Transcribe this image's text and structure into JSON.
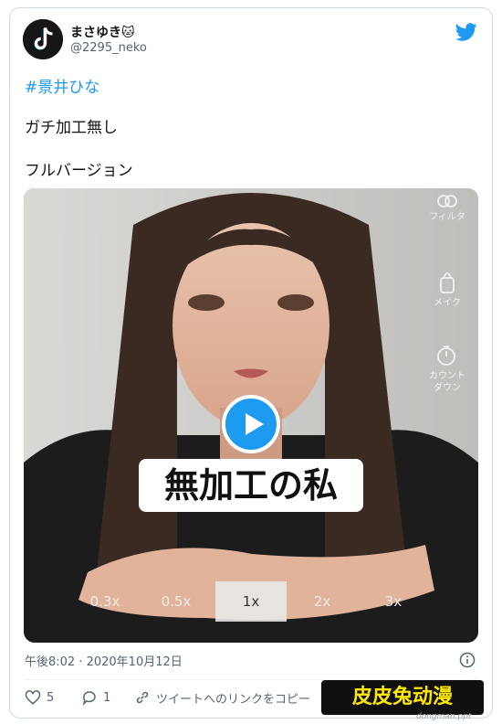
{
  "tweet": {
    "display_name": "まさゆき🐱",
    "handle": "@2295_neko",
    "hashtag": "#景井ひな",
    "text_line1": "ガチ加工無し",
    "text_line2": "フルバージョン",
    "timestamp": "午後8:02 · 2020年10月12日"
  },
  "video": {
    "caption": "無加工の私",
    "tools": [
      {
        "label": "フィルタ",
        "icon": "filter-icon"
      },
      {
        "label": "メイク",
        "icon": "makeup-icon"
      },
      {
        "label": "カウント\nダウン",
        "icon": "timer-icon"
      }
    ],
    "tool_labels": {
      "filter": "フィルタ",
      "makeup": "メイク",
      "countdown1": "カウント",
      "countdown2": "ダウン"
    },
    "zoom_options": [
      "0.3x",
      "0.5x",
      "1x",
      "2x",
      "3x"
    ],
    "selected_zoom": "1x"
  },
  "actions": {
    "like_count": "5",
    "reply_count": "1",
    "copy_link": "ツイートへのリンクをコピー"
  },
  "watermark": {
    "text": "皮皮兔动漫",
    "sub": "dongman.ppt"
  },
  "colors": {
    "accent": "#1d9bf0",
    "watermark_text": "#ffe800"
  }
}
